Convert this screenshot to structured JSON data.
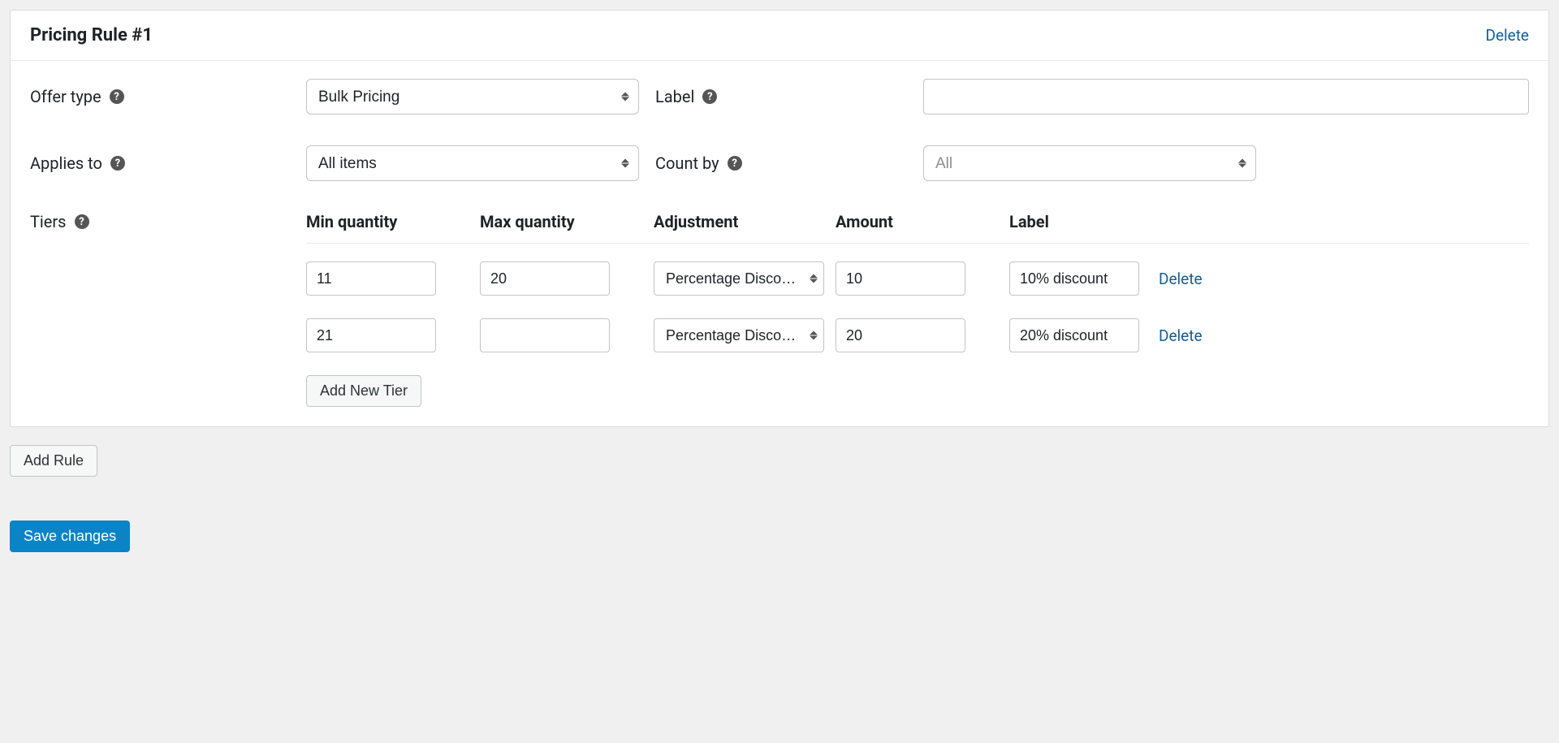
{
  "rule": {
    "title": "Pricing Rule #1",
    "delete_label": "Delete",
    "fields": {
      "offer_type": {
        "label": "Offer type",
        "value": "Bulk Pricing"
      },
      "label": {
        "label": "Label",
        "value": ""
      },
      "applies_to": {
        "label": "Applies to",
        "value": "All items"
      },
      "count_by": {
        "label": "Count by",
        "value": "All"
      },
      "tiers_label": "Tiers"
    },
    "tiers": {
      "headers": {
        "min": "Min quantity",
        "max": "Max quantity",
        "adjustment": "Adjustment",
        "amount": "Amount",
        "label": "Label"
      },
      "rows": [
        {
          "min": "11",
          "max": "20",
          "adjustment": "Percentage Discount",
          "amount": "10",
          "label": "10% discount"
        },
        {
          "min": "21",
          "max": "",
          "adjustment": "Percentage Discount",
          "amount": "20",
          "label": "20% discount"
        }
      ],
      "add_label": "Add New Tier",
      "row_delete_label": "Delete"
    }
  },
  "buttons": {
    "add_rule": "Add Rule",
    "save": "Save changes"
  }
}
